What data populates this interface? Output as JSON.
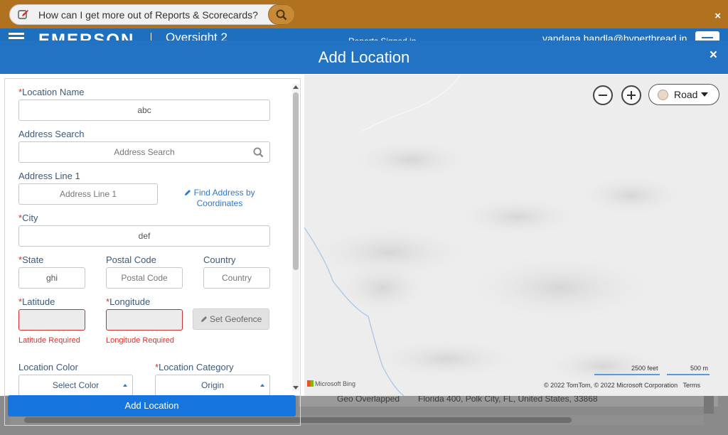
{
  "helpbar": {
    "question": "How can I get more out of Reports & Scorecards?",
    "close": "×"
  },
  "app_header": {
    "logo": "EMERSON",
    "app_name": "Oversight 2",
    "middle_text": "Reports Signed in",
    "user": "vandana.handla@hyperthread.in"
  },
  "background_table": {
    "status": "Geo Overlapped",
    "address": "Florida 400, Polk City, FL, United States, 33868"
  },
  "modal": {
    "title": "Add Location",
    "close": "×",
    "form": {
      "location_name": {
        "label": "Location Name",
        "required": "*",
        "value": "abc"
      },
      "address_search": {
        "label": "Address Search",
        "placeholder": "Address Search"
      },
      "address_line1": {
        "label": "Address Line 1",
        "placeholder": "Address Line 1"
      },
      "find_address_link": "Find Address by Coordinates",
      "city": {
        "label": "City",
        "required": "*",
        "value": "def"
      },
      "state": {
        "label": "State",
        "required": "*",
        "value": "ghi"
      },
      "postal_code": {
        "label": "Postal Code",
        "placeholder": "Postal Code"
      },
      "country": {
        "label": "Country",
        "placeholder": "Country"
      },
      "latitude": {
        "label": "Latitude",
        "required": "*",
        "error": "Latitude Required"
      },
      "longitude": {
        "label": "Longitude",
        "required": "*",
        "error": "Longitude Required"
      },
      "set_geofence": "Set Geofence",
      "location_color": {
        "label": "Location Color",
        "value": "Select Color"
      },
      "location_category": {
        "label": "Location Category",
        "required": "*",
        "value": "Origin"
      }
    },
    "submit_label": "Add Location",
    "map": {
      "map_type": "Road",
      "scale_feet": "2500 feet",
      "scale_m": "500 m",
      "provider": "Microsoft Bing",
      "copyright": "© 2022 TomTom, © 2022 Microsoft Corporation",
      "terms": "Terms"
    }
  }
}
